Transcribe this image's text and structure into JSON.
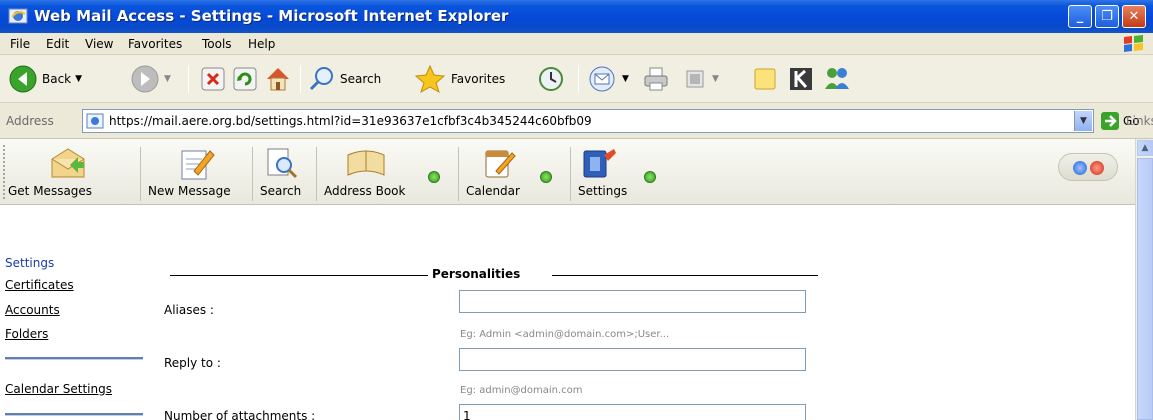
{
  "window": {
    "title": "Web Mail Access - Settings - Microsoft Internet Explorer",
    "controls": {
      "minimize": "_",
      "maximize": "❐",
      "close": "✕"
    }
  },
  "menu": [
    "File",
    "Edit",
    "View",
    "Favorites",
    "Tools",
    "Help"
  ],
  "toolbar": {
    "back": "Back",
    "search": "Search",
    "favorites": "Favorites"
  },
  "address": {
    "label": "Address",
    "url": "https://mail.aere.org.bd/settings.html?id=31e93637e1cfbf3c4b345244c60bfb09",
    "go": "Go",
    "links": "Links"
  },
  "mailbar": {
    "buttons": [
      "Get Messages",
      "New Message",
      "Search",
      "Address Book",
      "Calendar",
      "Settings"
    ]
  },
  "sidebar": {
    "current": "Settings",
    "links": [
      "Certificates",
      "Accounts",
      "Folders"
    ],
    "calendar": "Calendar Settings"
  },
  "form": {
    "legend": "Personalities",
    "aliases_label": "Aliases :",
    "aliases_value": "",
    "aliases_hint": "Eg: Admin <admin@domain.com>;User...",
    "reply_label": "Reply to :",
    "reply_value": "",
    "reply_hint": "Eg: admin@domain.com",
    "attachments_label": "Number of attachments :",
    "attachments_value": "1"
  }
}
